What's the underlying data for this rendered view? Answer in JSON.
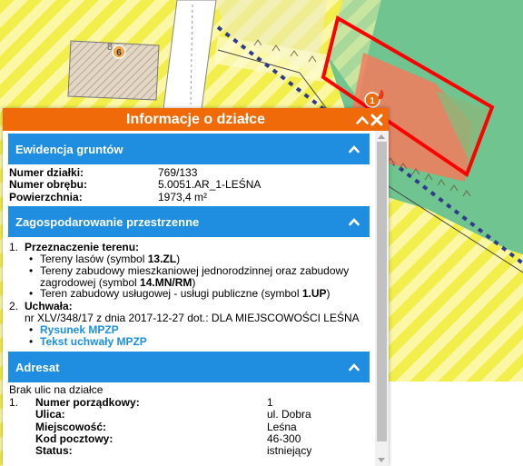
{
  "map": {
    "building_number": "8",
    "marker_6": "6",
    "marker_1": "1",
    "colors": {
      "forest": "#6fc48f",
      "hatch_yellow": "#f7f26a",
      "parcel_outline": "#ff0000",
      "marker": "#f06a0a"
    }
  },
  "panel": {
    "title": "Informacje o działce",
    "header_color": "#f06a0a",
    "section_color": "#1f8de0",
    "icons": {
      "collapse": "chevron-up-icon",
      "close": "close-icon"
    }
  },
  "ewidencja": {
    "title": "Ewidencja gruntów",
    "rows": [
      {
        "label": "Numer działki:",
        "value": "769/133"
      },
      {
        "label": "Numer obrębu:",
        "value": "5.0051.AR_1-LEŚNA"
      },
      {
        "label": "Powierzchnia:",
        "value": "1973,4 m²"
      }
    ]
  },
  "zagospodarowanie": {
    "title": "Zagospodarowanie przestrzenne",
    "item1_num": "1.",
    "item1_title": "Przeznaczenie terenu:",
    "item2_num": "2.",
    "item2_title": "Uchwała:",
    "b1_text": "Tereny lasów (symbol ",
    "b1_sym": "13.ZL",
    "b1_end": ")",
    "b2_text1": "Tereny zabudowy mieszkaniowej jednorodzinnej oraz zabudowy",
    "b2_text2": "zagrodowej (symbol ",
    "b2_sym": "14.MN/RM",
    "b2_end": ")",
    "b3_text": "Teren zabudowy usługowej - usługi publiczne (symbol ",
    "b3_sym": "1.UP",
    "b3_end": ")",
    "uchwala_text": "nr XLV/348/17 z dnia 2017-12-27 dot.: DLA MIEJSCOWOŚCI LEŚNA",
    "link1": "Rysunek MPZP",
    "link2": "Tekst uchwały MPZP"
  },
  "adresat": {
    "title": "Adresat",
    "note": "Brak ulic na działce",
    "item_num": "1.",
    "rows": [
      {
        "label": "Numer porządkowy:",
        "value": "1"
      },
      {
        "label": "Ulica:",
        "value": "ul. Dobra"
      },
      {
        "label": "Miejscowość:",
        "value": "Leśna"
      },
      {
        "label": "Kod pocztowy:",
        "value": "46-300"
      },
      {
        "label": "Status:",
        "value": "istniejący"
      }
    ]
  }
}
